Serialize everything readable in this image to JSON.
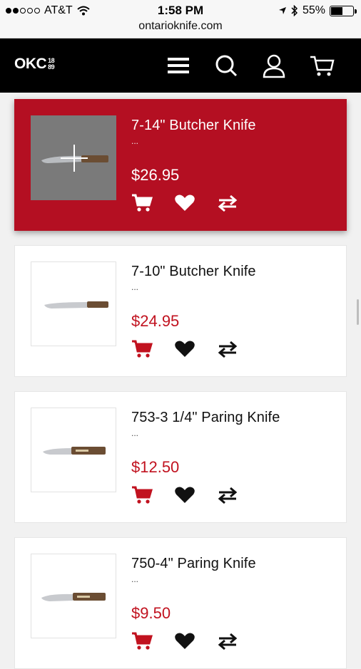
{
  "status_bar": {
    "carrier": "AT&T",
    "time": "1:58 PM",
    "battery": "55%",
    "battery_level": 0.55
  },
  "browser": {
    "url": "ontarioknife.com"
  },
  "header": {
    "logo_text": "OKC",
    "logo_year_top": "18",
    "logo_year_bottom": "89"
  },
  "colors": {
    "brand_red": "#b40f22",
    "price_red": "#c1121f",
    "header_bg": "#000000"
  },
  "products": [
    {
      "title": "7-14\" Butcher Knife",
      "desc": "...",
      "price": "$26.95"
    },
    {
      "title": "7-10\" Butcher Knife",
      "desc": "...",
      "price": "$24.95"
    },
    {
      "title": "753-3 1/4\" Paring Knife",
      "desc": "...",
      "price": "$12.50"
    },
    {
      "title": "750-4\" Paring Knife",
      "desc": "...",
      "price": "$9.50"
    }
  ]
}
